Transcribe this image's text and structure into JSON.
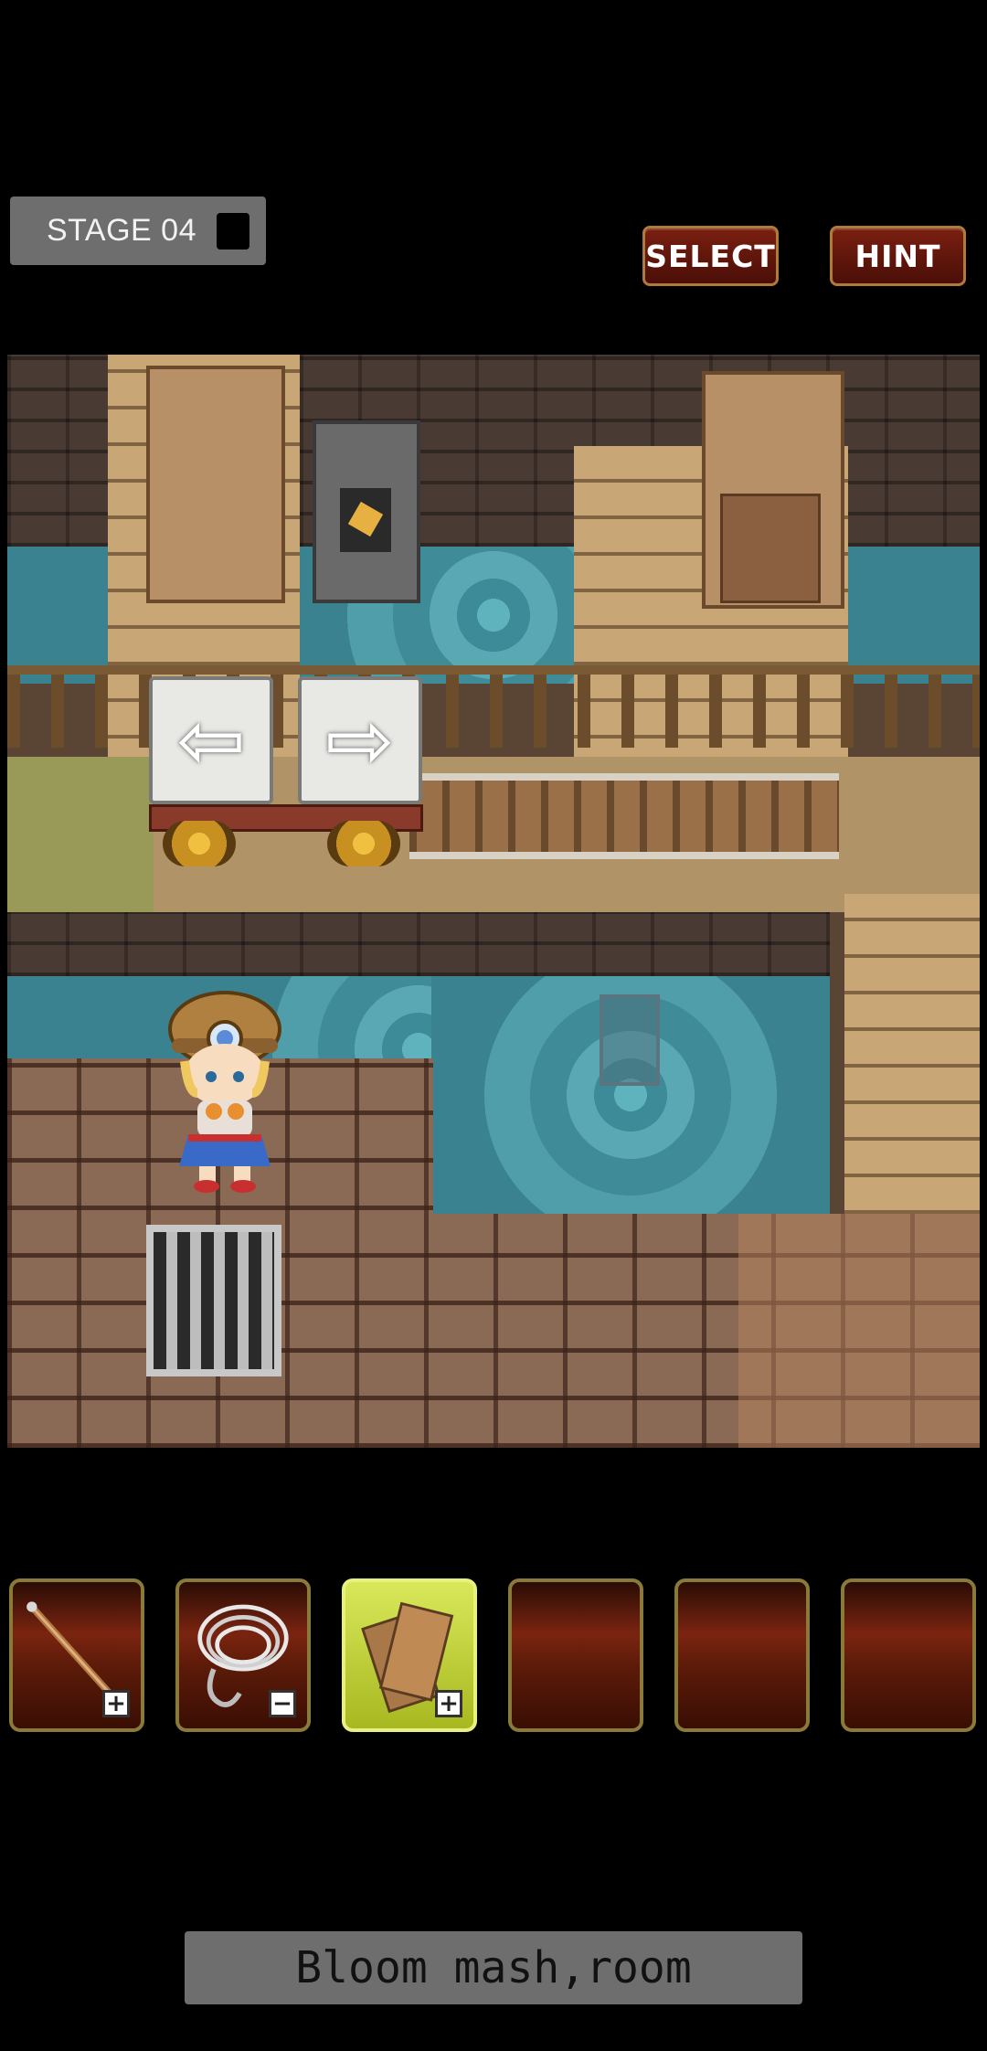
{
  "header": {
    "stage_label": "STAGE 04",
    "select_label": "SELECT",
    "hint_label": "HINT"
  },
  "scene": {
    "left_arrow": "⇦",
    "right_arrow": "⇨"
  },
  "inventory": {
    "slots": [
      {
        "item": "wooden-stick",
        "sign": "+",
        "selected": false
      },
      {
        "item": "rope-grappling-hook",
        "sign": "−",
        "selected": false
      },
      {
        "item": "wooden-boards",
        "sign": "+",
        "selected": true
      },
      {
        "item": "",
        "sign": "",
        "selected": false
      },
      {
        "item": "",
        "sign": "",
        "selected": false
      },
      {
        "item": "",
        "sign": "",
        "selected": false
      }
    ]
  },
  "caption": {
    "text": "Bloom mash,room"
  }
}
